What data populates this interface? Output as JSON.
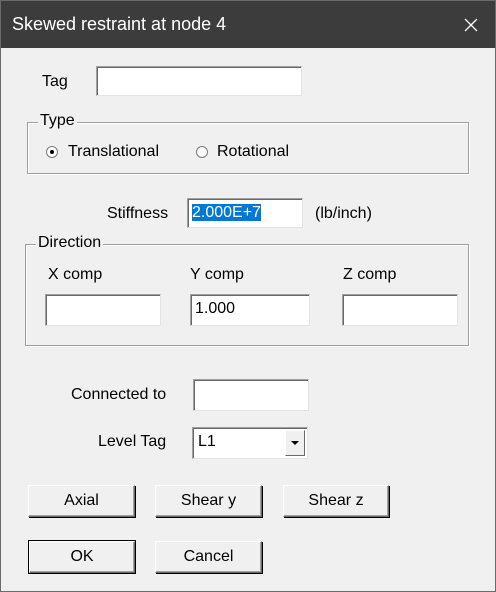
{
  "window": {
    "title": "Skewed restraint at node 4"
  },
  "tag": {
    "label": "Tag",
    "value": ""
  },
  "type_group": {
    "legend": "Type",
    "options": [
      {
        "label": "Translational",
        "selected": true
      },
      {
        "label": "Rotational",
        "selected": false
      }
    ]
  },
  "stiffness": {
    "label": "Stiffness",
    "value": "2.000E+7",
    "unit": "(lb/inch)"
  },
  "direction": {
    "legend": "Direction",
    "x": {
      "label": "X comp",
      "value": ""
    },
    "y": {
      "label": "Y comp",
      "value": "1.000"
    },
    "z": {
      "label": "Z comp",
      "value": ""
    }
  },
  "connected_to": {
    "label": "Connected to",
    "value": ""
  },
  "level_tag": {
    "label": "Level Tag",
    "value": "L1"
  },
  "buttons": {
    "axial": "Axial",
    "shear_y": "Shear y",
    "shear_z": "Shear z",
    "ok": "OK",
    "cancel": "Cancel"
  }
}
